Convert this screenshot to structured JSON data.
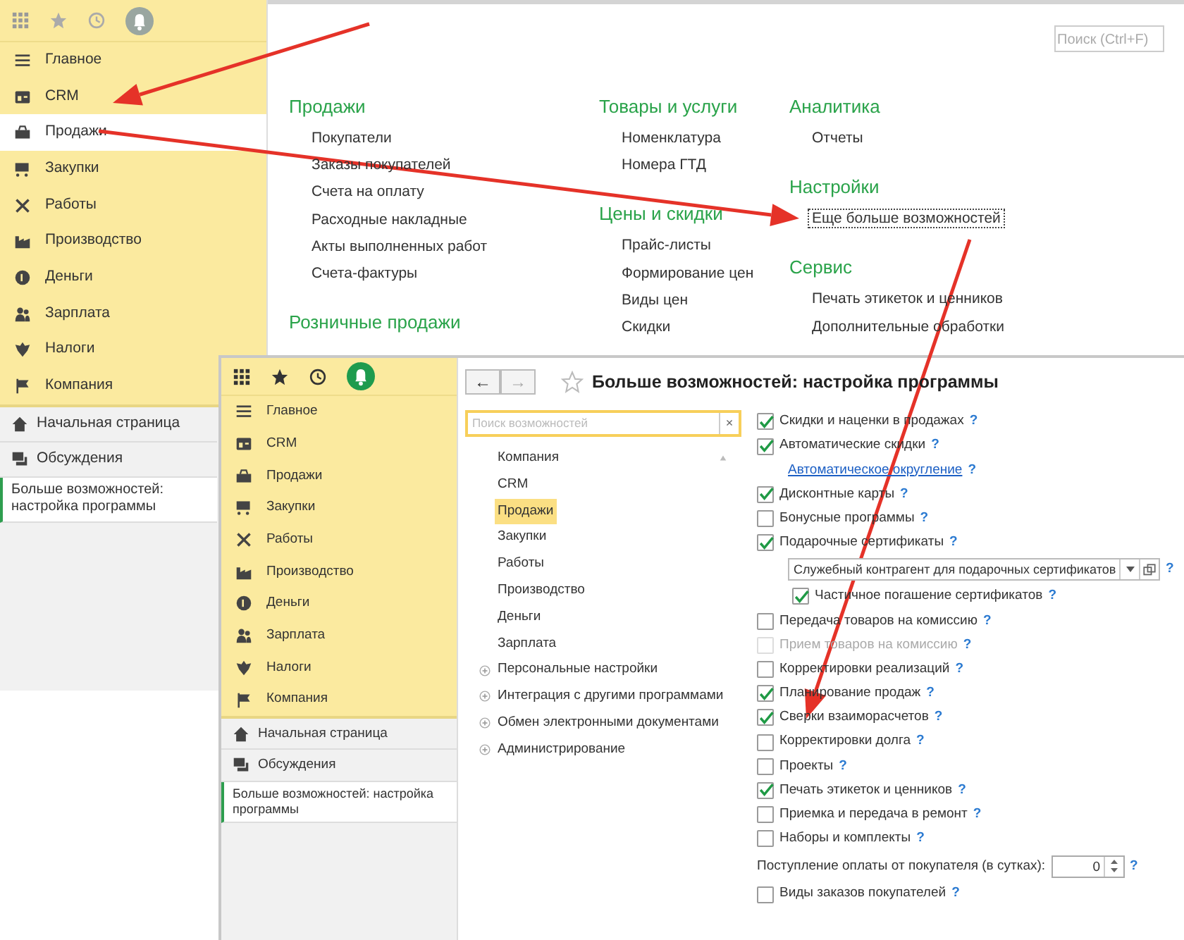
{
  "back_window": {
    "sidebar": {
      "notifications_active": false,
      "sections": [
        {
          "label": "Главное",
          "selected": false
        },
        {
          "label": "CRM",
          "selected": false
        },
        {
          "label": "Продажи",
          "selected": true
        },
        {
          "label": "Закупки",
          "selected": false
        },
        {
          "label": "Работы",
          "selected": false
        },
        {
          "label": "Производство",
          "selected": false
        },
        {
          "label": "Деньги",
          "selected": false
        },
        {
          "label": "Зарплата",
          "selected": false
        },
        {
          "label": "Налоги",
          "selected": false
        },
        {
          "label": "Компания",
          "selected": false
        }
      ],
      "links": [
        {
          "label": "Начальная страница"
        },
        {
          "label": "Обсуждения"
        }
      ],
      "open_windows": [
        {
          "title": "Больше возможностей: настройка программы"
        }
      ]
    },
    "search": {
      "placeholder": "Поиск (Ctrl+F)"
    },
    "columns": [
      [
        {
          "heading": "Продажи",
          "items": [
            {
              "label": "Покупатели",
              "focused": false
            },
            {
              "label": "Заказы покупателей",
              "focused": false
            },
            {
              "label": "Счета на оплату",
              "focused": false
            },
            {
              "label": "Расходные накладные",
              "focused": false
            },
            {
              "label": "Акты выполненных работ",
              "focused": false
            },
            {
              "label": "Счета-фактуры",
              "focused": false
            }
          ]
        },
        {
          "heading": "Розничные продажи"
        }
      ],
      [
        {
          "heading": "Товары и услуги",
          "items": [
            {
              "label": "Номенклатура",
              "focused": false
            },
            {
              "label": "Номера ГТД",
              "focused": false
            }
          ]
        },
        {
          "heading": "Цены и скидки",
          "items": [
            {
              "label": "Прайс-листы",
              "focused": false
            },
            {
              "label": "Формирование цен",
              "focused": false
            },
            {
              "label": "Виды цен",
              "focused": false
            },
            {
              "label": "Скидки",
              "focused": false
            }
          ]
        }
      ],
      [
        {
          "heading": "Аналитика",
          "items": [
            {
              "label": "Отчеты",
              "focused": false
            }
          ]
        },
        {
          "heading": "Настройки",
          "items": [
            {
              "label": "Еще больше возможностей",
              "focused": true
            }
          ]
        },
        {
          "heading": "Сервис",
          "items": [
            {
              "label": "Печать этикеток и ценников",
              "focused": false
            },
            {
              "label": "Дополнительные обработки",
              "focused": false
            }
          ]
        }
      ]
    ]
  },
  "front_window": {
    "sidebar": {
      "notifications_active": true,
      "sections": [
        {
          "label": "Главное",
          "selected": false
        },
        {
          "label": "CRM",
          "selected": false
        },
        {
          "label": "Продажи",
          "selected": false
        },
        {
          "label": "Закупки",
          "selected": false
        },
        {
          "label": "Работы",
          "selected": false
        },
        {
          "label": "Производство",
          "selected": false
        },
        {
          "label": "Деньги",
          "selected": false
        },
        {
          "label": "Зарплата",
          "selected": false
        },
        {
          "label": "Налоги",
          "selected": false
        },
        {
          "label": "Компания",
          "selected": false
        }
      ],
      "links": [
        {
          "label": "Начальная страница"
        },
        {
          "label": "Обсуждения"
        }
      ],
      "open_windows": [
        {
          "title": "Больше возможностей: настройка программы"
        }
      ]
    },
    "nav": {
      "back": {
        "label": "←",
        "disabled": false
      },
      "forward": {
        "label": "→",
        "disabled": true
      }
    },
    "favorite": false,
    "title": "Больше возможностей: настройка программы",
    "search": {
      "placeholder": "Поиск возможностей",
      "clear": "×"
    },
    "tree": [
      {
        "label": "Компания",
        "kind": "section",
        "selected": false
      },
      {
        "label": "CRM",
        "kind": "section",
        "selected": false
      },
      {
        "label": "Продажи",
        "kind": "section",
        "selected": true
      },
      {
        "label": "Закупки",
        "kind": "section",
        "selected": false
      },
      {
        "label": "Работы",
        "kind": "section",
        "selected": false
      },
      {
        "label": "Производство",
        "kind": "section",
        "selected": false
      },
      {
        "label": "Деньги",
        "kind": "section",
        "selected": false
      },
      {
        "label": "Зарплата",
        "kind": "section",
        "selected": false
      },
      {
        "label": "Персональные настройки",
        "kind": "group",
        "selected": false,
        "expanded": false
      },
      {
        "label": "Интеграция с другими программами",
        "kind": "group",
        "selected": false,
        "expanded": false
      },
      {
        "label": "Обмен электронными документами",
        "kind": "group",
        "selected": false,
        "expanded": false
      },
      {
        "label": "Администрирование",
        "kind": "group",
        "selected": false,
        "expanded": false
      }
    ],
    "settings": [
      {
        "kind": "checkbox",
        "label": "Скидки и наценки в продажах",
        "checked": true,
        "disabled": false,
        "help": "?"
      },
      {
        "kind": "checkbox",
        "label": "Автоматические скидки",
        "checked": true,
        "disabled": false,
        "help": "?",
        "children": [
          {
            "kind": "link",
            "label": "Автоматическое округление",
            "help": "?"
          }
        ]
      },
      {
        "kind": "checkbox",
        "label": "Дисконтные карты",
        "checked": true,
        "disabled": false,
        "help": "?"
      },
      {
        "kind": "checkbox",
        "label": "Бонусные программы",
        "checked": false,
        "disabled": false,
        "help": "?"
      },
      {
        "kind": "checkbox",
        "label": "Подарочные сертификаты",
        "checked": true,
        "disabled": false,
        "help": "?",
        "children": [
          {
            "kind": "select",
            "value": "Служебный контрагент для подарочных сертификатов",
            "help": "?"
          },
          {
            "kind": "checkbox",
            "label": "Частичное погашение сертификатов",
            "checked": true,
            "disabled": false,
            "help": "?"
          }
        ]
      },
      {
        "kind": "checkbox",
        "label": "Передача товаров на комиссию",
        "checked": false,
        "disabled": false,
        "help": "?"
      },
      {
        "kind": "checkbox",
        "label": "Прием товаров на комиссию",
        "checked": false,
        "disabled": true,
        "help": "?"
      },
      {
        "kind": "checkbox",
        "label": "Корректировки реализаций",
        "checked": false,
        "disabled": false,
        "help": "?"
      },
      {
        "kind": "checkbox",
        "label": "Планирование продаж",
        "checked": true,
        "disabled": false,
        "help": "?"
      },
      {
        "kind": "checkbox",
        "label": "Сверки взаиморасчетов",
        "checked": true,
        "disabled": false,
        "help": "?"
      },
      {
        "kind": "checkbox",
        "label": "Корректировки долга",
        "checked": false,
        "disabled": false,
        "help": "?"
      },
      {
        "kind": "checkbox",
        "label": "Проекты",
        "checked": false,
        "disabled": false,
        "help": "?"
      },
      {
        "kind": "checkbox",
        "label": "Печать этикеток и ценников",
        "checked": true,
        "disabled": false,
        "help": "?"
      },
      {
        "kind": "checkbox",
        "label": "Приемка и передача в ремонт",
        "checked": false,
        "disabled": false,
        "help": "?"
      },
      {
        "kind": "checkbox",
        "label": "Наборы и комплекты",
        "checked": false,
        "disabled": false,
        "help": "?"
      },
      {
        "kind": "number",
        "label": "Поступление оплаты от покупателя (в сутках):",
        "value": "0",
        "help": "?"
      },
      {
        "kind": "checkbox",
        "label": "Виды заказов покупателей",
        "checked": false,
        "disabled": false,
        "help": "?"
      }
    ]
  }
}
